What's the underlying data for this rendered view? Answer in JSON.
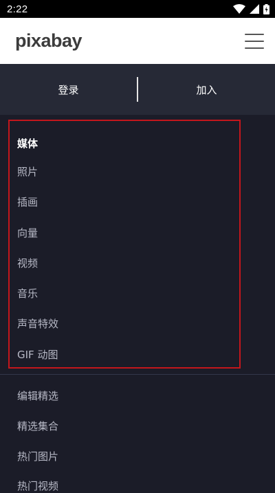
{
  "status_bar": {
    "time": "2:22",
    "icons": [
      "wifi-icon",
      "signal-icon",
      "battery-icon"
    ]
  },
  "header": {
    "logo": "pixabay",
    "menu_icon": "hamburger-menu-icon"
  },
  "auth": {
    "login_label": "登录",
    "join_label": "加入"
  },
  "menu": {
    "media_section": {
      "title": "媒体",
      "items": [
        "照片",
        "插画",
        "向量",
        "视频",
        "音乐",
        "声音特效",
        "GIF 动图"
      ]
    },
    "more_items": [
      "编辑精选",
      "精选集合",
      "热门图片",
      "热门视频"
    ]
  },
  "colors": {
    "background": "#1b1c28",
    "auth_bar": "#262936",
    "highlight": "#c4161c",
    "item_text": "#b7b9c6"
  }
}
